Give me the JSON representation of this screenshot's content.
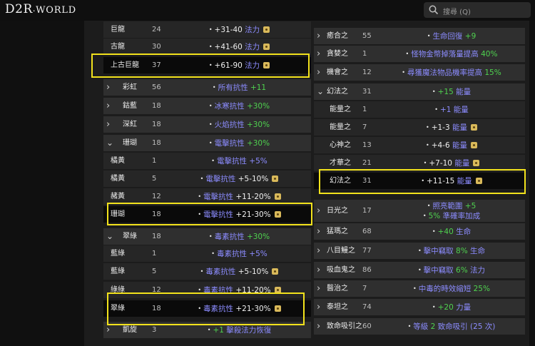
{
  "header": {
    "logo_main": "D2R",
    "logo_dot": ".",
    "logo_rest": "WORLD",
    "search_placeholder": "搜尋 (Q)"
  },
  "left_rows": [
    {
      "name": "巨龍",
      "level": "24",
      "bullet": "•",
      "parts": [
        {
          "t": "+31-40",
          "c": "num"
        },
        {
          "t": " 法力",
          "c": "blue"
        }
      ],
      "dice": true
    },
    {
      "name": "古龍",
      "level": "30",
      "bullet": "•",
      "parts": [
        {
          "t": "+41-60",
          "c": "num"
        },
        {
          "t": " 法力",
          "c": "blue"
        }
      ],
      "dice": true
    },
    {
      "name": "上古巨龍",
      "level": "37",
      "bullet": "•",
      "parts": [
        {
          "t": "+61-90",
          "c": "num"
        },
        {
          "t": " 法力",
          "c": "blue"
        }
      ],
      "dice": true
    },
    {
      "name": "彩虹",
      "level": "56",
      "parts": [
        {
          "t": "所有抗性 ",
          "c": "blue"
        },
        {
          "t": "+11",
          "c": "green"
        }
      ],
      "dice": false
    },
    {
      "name": "鈷藍",
      "level": "18",
      "parts": [
        {
          "t": "冰寒抗性 ",
          "c": "blue"
        },
        {
          "t": "+30%",
          "c": "green"
        }
      ],
      "dice": false
    },
    {
      "name": "深紅",
      "level": "18",
      "parts": [
        {
          "t": "火焰抗性 ",
          "c": "blue"
        },
        {
          "t": "+30%",
          "c": "green"
        }
      ],
      "dice": false
    },
    {
      "name": "珊瑚",
      "level": "18",
      "parts": [
        {
          "t": "電擊抗性 ",
          "c": "blue"
        },
        {
          "t": "+30%",
          "c": "green"
        }
      ],
      "dice": false
    },
    {
      "name": "橘黃",
      "level": "1",
      "bullet": "•",
      "parts": [
        {
          "t": "電擊抗性 ",
          "c": "blue"
        },
        {
          "t": "+5%",
          "c": "blue"
        }
      ],
      "dice": false
    },
    {
      "name": "橘黃",
      "level": "5",
      "bullet": "•",
      "parts": [
        {
          "t": "電擊抗性 ",
          "c": "blue"
        },
        {
          "t": "+5-10%",
          "c": "num"
        }
      ],
      "dice": true
    },
    {
      "name": "赭黃",
      "level": "12",
      "bullet": "•",
      "parts": [
        {
          "t": "電擊抗性 ",
          "c": "blue"
        },
        {
          "t": "+11-20%",
          "c": "num"
        }
      ],
      "dice": true
    },
    {
      "name": "珊瑚",
      "level": "18",
      "bullet": "•",
      "parts": [
        {
          "t": "電擊抗性 ",
          "c": "blue"
        },
        {
          "t": "+21-30%",
          "c": "num"
        }
      ],
      "dice": true
    },
    {
      "name": "翠綠",
      "level": "18",
      "parts": [
        {
          "t": "毒素抗性 ",
          "c": "blue"
        },
        {
          "t": "+30%",
          "c": "green"
        }
      ],
      "dice": false
    },
    {
      "name": "藍綠",
      "level": "1",
      "bullet": "•",
      "parts": [
        {
          "t": "毒素抗性 ",
          "c": "blue"
        },
        {
          "t": "+5%",
          "c": "blue"
        }
      ],
      "dice": false
    },
    {
      "name": "藍綠",
      "level": "5",
      "bullet": "•",
      "parts": [
        {
          "t": "毒素抗性 ",
          "c": "blue"
        },
        {
          "t": "+5-10%",
          "c": "num"
        }
      ],
      "dice": true
    },
    {
      "name": "綠綠",
      "level": "12",
      "bullet": "•",
      "parts": [
        {
          "t": "毒素抗性 ",
          "c": "blue"
        },
        {
          "t": "+11-20%",
          "c": "num"
        }
      ],
      "dice": true
    },
    {
      "name": "翠綠",
      "level": "18",
      "bullet": "•",
      "parts": [
        {
          "t": "毒素抗性 ",
          "c": "blue"
        },
        {
          "t": "+21-30%",
          "c": "num"
        }
      ],
      "dice": true
    },
    {
      "name": "凱旋",
      "level": "3",
      "parts": [
        {
          "t": "+1",
          "c": "green"
        },
        {
          "t": " 擊殺法力恢復",
          "c": "blue"
        }
      ],
      "dice": false
    }
  ],
  "right_rows": [
    {
      "name": "癒合之",
      "level": "55",
      "parts": [
        {
          "t": "生命回復 ",
          "c": "blue"
        },
        {
          "t": "+9",
          "c": "green"
        }
      ],
      "dice": false
    },
    {
      "name": "貪婪之",
      "level": "1",
      "parts": [
        {
          "t": "怪物金幣掉落量提高 ",
          "c": "blue"
        },
        {
          "t": "40%",
          "c": "green"
        }
      ],
      "dice": false
    },
    {
      "name": "機會之",
      "level": "12",
      "parts": [
        {
          "t": "尋獲魔法物品機率提高 ",
          "c": "blue"
        },
        {
          "t": "15%",
          "c": "green"
        }
      ],
      "dice": false
    },
    {
      "name": "幻法之",
      "level": "31",
      "parts": [
        {
          "t": "+15",
          "c": "green"
        },
        {
          "t": " 能量",
          "c": "blue"
        }
      ],
      "dice": false
    },
    {
      "name": "能量之",
      "level": "1",
      "bullet": "•",
      "parts": [
        {
          "t": "+1",
          "c": "blue"
        },
        {
          "t": " 能量",
          "c": "blue"
        }
      ],
      "dice": false
    },
    {
      "name": "能量之",
      "level": "7",
      "bullet": "•",
      "parts": [
        {
          "t": "+1-3",
          "c": "num"
        },
        {
          "t": " 能量",
          "c": "blue"
        }
      ],
      "dice": true
    },
    {
      "name": "心神之",
      "level": "13",
      "bullet": "•",
      "parts": [
        {
          "t": "+4-6",
          "c": "num"
        },
        {
          "t": " 能量",
          "c": "blue"
        }
      ],
      "dice": true
    },
    {
      "name": "才華之",
      "level": "21",
      "bullet": "•",
      "parts": [
        {
          "t": "+7-10",
          "c": "num"
        },
        {
          "t": " 能量",
          "c": "blue"
        }
      ],
      "dice": true
    },
    {
      "name": "幻法之",
      "level": "31",
      "bullet": "•",
      "parts": [
        {
          "t": "+11-15",
          "c": "num"
        },
        {
          "t": " 能量",
          "c": "blue"
        }
      ],
      "dice": true
    },
    {
      "name": "日光之",
      "level": "17",
      "line1": [
        {
          "t": "照亮範圍 ",
          "c": "blue"
        },
        {
          "t": "+5",
          "c": "green"
        }
      ],
      "line2": [
        {
          "t": "5%",
          "c": "green"
        },
        {
          "t": " 準確率加成",
          "c": "blue"
        }
      ]
    },
    {
      "name": "猛瑪之",
      "level": "68",
      "parts": [
        {
          "t": "+40",
          "c": "green"
        },
        {
          "t": " 生命",
          "c": "blue"
        }
      ],
      "dice": false
    },
    {
      "name": "八目鰻之",
      "level": "77",
      "parts": [
        {
          "t": "擊中竊取 ",
          "c": "blue"
        },
        {
          "t": "8%",
          "c": "green"
        },
        {
          "t": " 生命",
          "c": "blue"
        }
      ],
      "dice": false
    },
    {
      "name": "吸血鬼之",
      "level": "86",
      "parts": [
        {
          "t": "擊中竊取 ",
          "c": "blue"
        },
        {
          "t": "6%",
          "c": "green"
        },
        {
          "t": " 法力",
          "c": "blue"
        }
      ],
      "dice": false
    },
    {
      "name": "醫治之",
      "level": "7",
      "parts": [
        {
          "t": "中毒的時效縮短 ",
          "c": "blue"
        },
        {
          "t": "25%",
          "c": "green"
        }
      ],
      "dice": false
    },
    {
      "name": "泰坦之",
      "level": "74",
      "parts": [
        {
          "t": "+20",
          "c": "green"
        },
        {
          "t": " 力量",
          "c": "blue"
        }
      ],
      "dice": false
    },
    {
      "name": "致命吸引之",
      "level": "60",
      "parts": [
        {
          "t": "等級 ",
          "c": "blue"
        },
        {
          "t": "2",
          "c": "green"
        },
        {
          "t": " 致命吸引",
          "c": "blue"
        },
        {
          "t": " (25 次)",
          "c": "blue"
        }
      ],
      "dice": false
    }
  ],
  "colors": {
    "accent_highlight": "#f2e21c",
    "attr_blue": "#8c8cff",
    "attr_green": "#4fd24f",
    "dice": "#d9b95a"
  }
}
